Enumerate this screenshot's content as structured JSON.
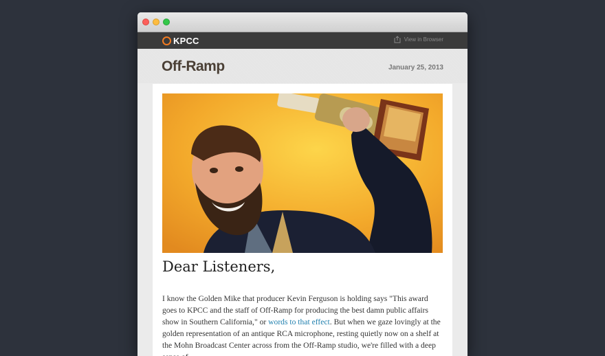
{
  "header": {
    "brand": "KPCC",
    "view_in_browser": "View in Browser"
  },
  "newsletter": {
    "logo": "Off-Ramp",
    "date": "January 25, 2013"
  },
  "article": {
    "greeting": "Dear Listeners,",
    "para_1": "I know the Golden Mike that producer Kevin Ferguson is holding says \"This award goes to KPCC and the staff of Off-Ramp for producing the best damn public affairs show in Southern California,\" or ",
    "link_text": "words to that effect",
    "para_2": ". But when we gaze lovingly at the golden representation of an antique RCA microphone, resting quietly now on a shelf at the Mohn Broadcast Center across from the Off-Ramp studio, we're filled with a deep sense of"
  },
  "colors": {
    "accent": "#f27b21",
    "link": "#1f7fae",
    "background": "#2d323c"
  }
}
